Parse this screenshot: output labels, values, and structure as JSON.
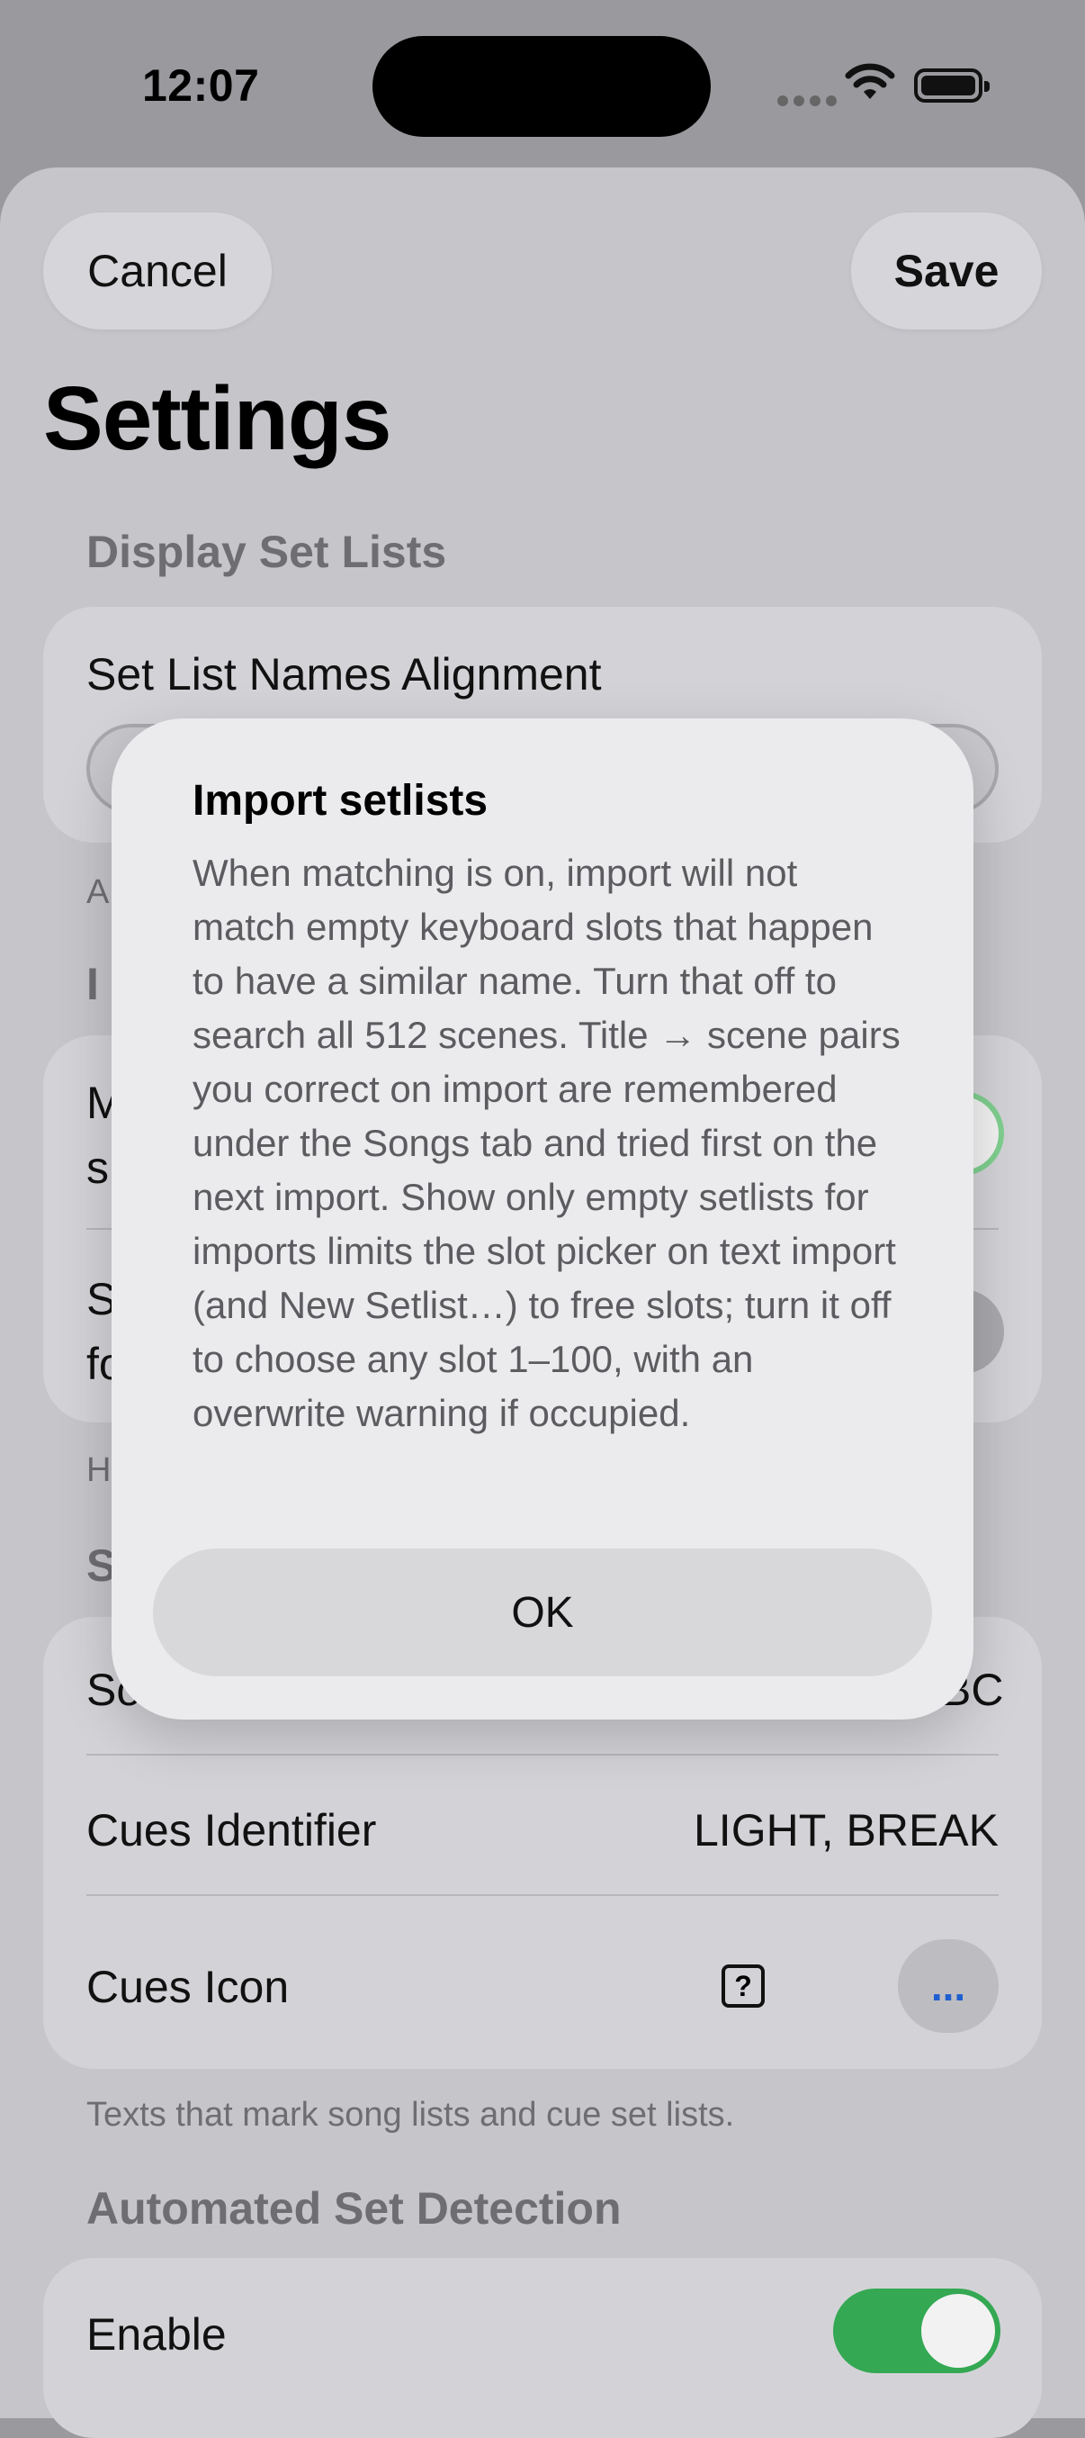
{
  "status": {
    "time": "12:07"
  },
  "nav": {
    "cancel": "Cancel",
    "save": "Save",
    "title": "Settings"
  },
  "sections": {
    "display": {
      "header": "Display Set Lists",
      "row_label": "Set List Names Alignment",
      "footer_partial": "A"
    },
    "import": {
      "header_partial": "I",
      "row1_partial_a": "M",
      "row1_partial_b": "s",
      "row2_partial_a": "S",
      "row2_partial_b": "fo",
      "footer_partial": "H"
    },
    "songs": {
      "header_partial": "S",
      "row1_partial": "So",
      "row1_value_partial": "BC",
      "cues_identifier_label": "Cues Identifier",
      "cues_identifier_value": "LIGHT, BREAK",
      "cues_icon_label": "Cues Icon",
      "cues_icon_symbol": "?",
      "more": "...",
      "footer": "Texts that mark song lists and cue set lists."
    },
    "automated": {
      "header": "Automated Set Detection",
      "enable_label": "Enable"
    }
  },
  "alert": {
    "title": "Import setlists",
    "body": "When matching is on, import will not match empty keyboard slots that happen to have a similar name. Turn that off to search all 512 scenes. Title → scene pairs you correct on import are remembered under the Songs tab and tried first on the next import. Show only empty setlists for imports limits the slot picker on text import (and New Setlist…) to free slots; turn it off to choose any slot 1–100, with an overwrite warning if occupied.",
    "ok": "OK"
  },
  "colors": {
    "toggle_on": "#34a853",
    "accent": "#1f5fd1"
  }
}
